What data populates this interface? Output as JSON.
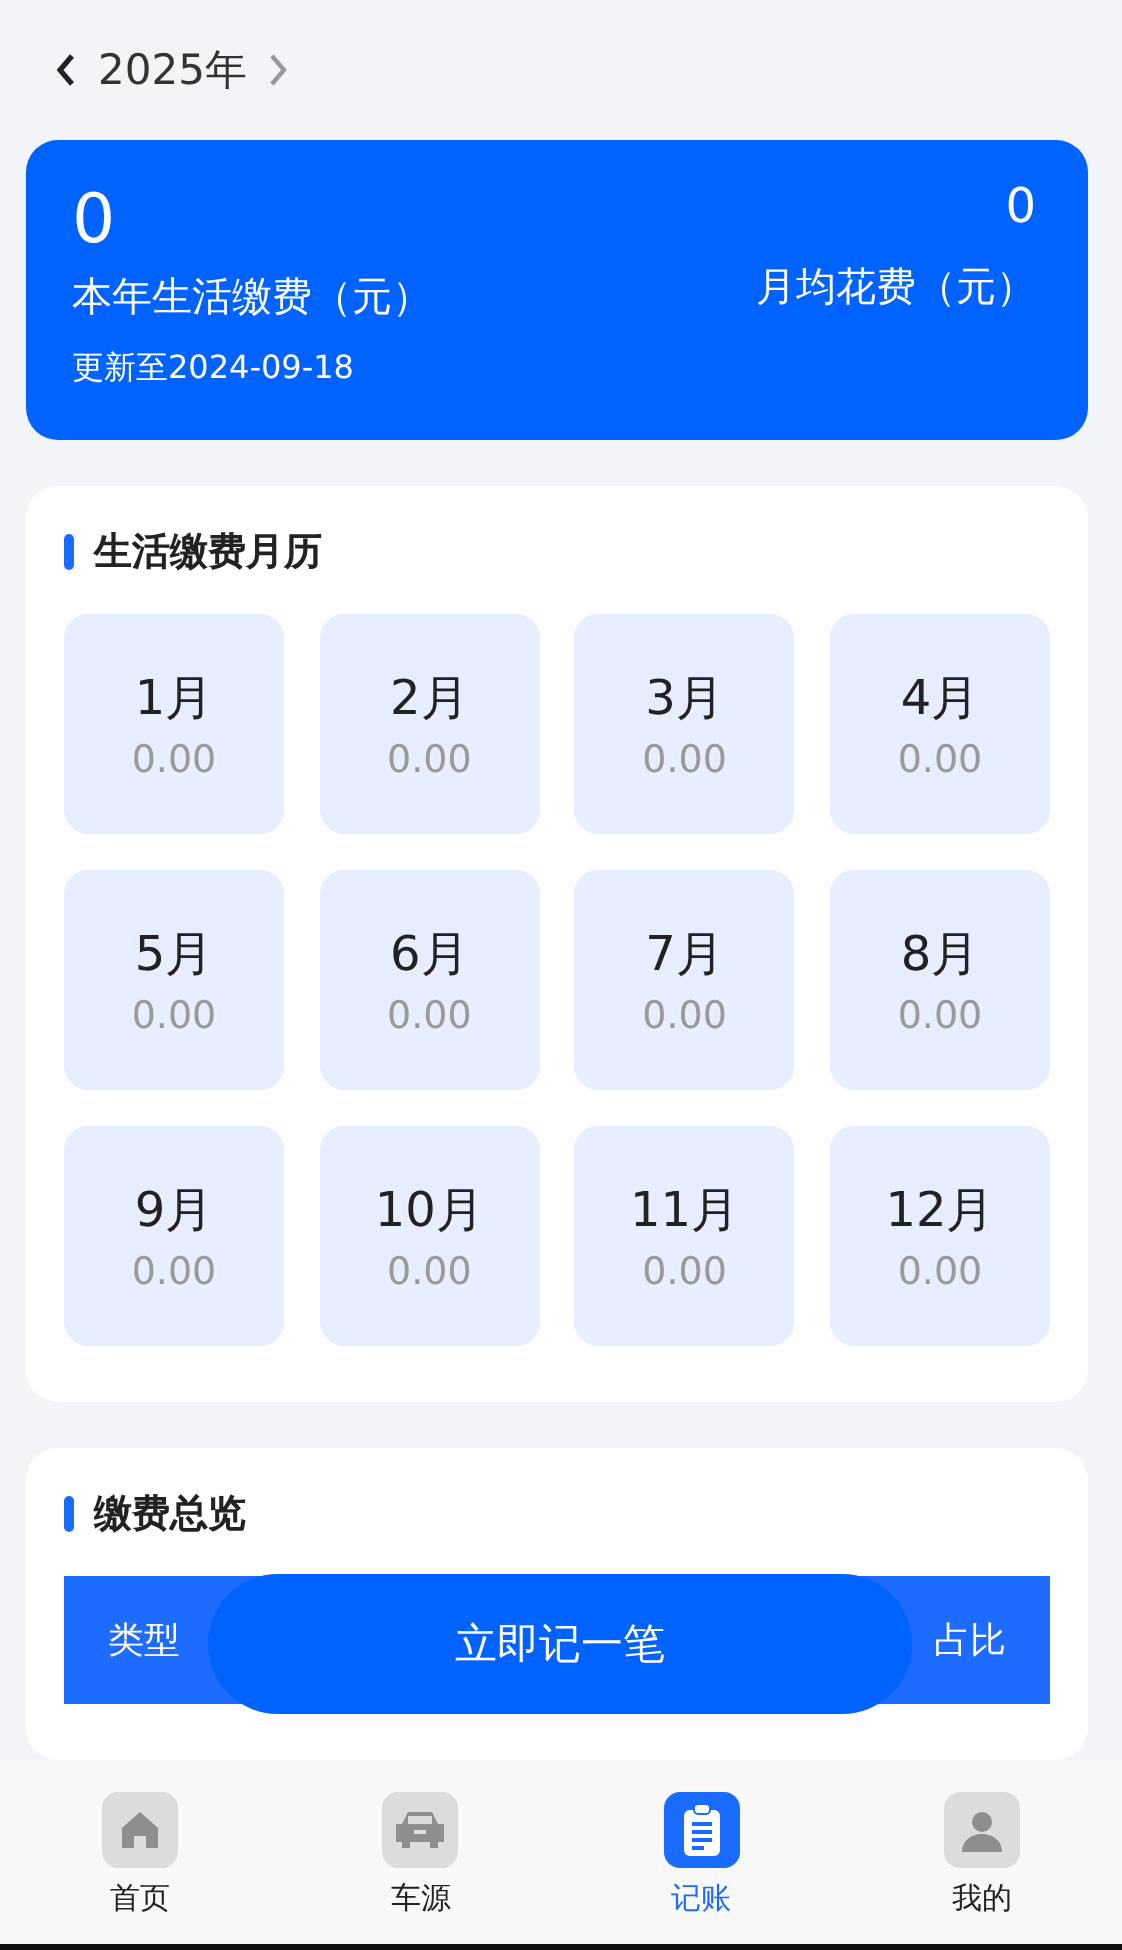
{
  "year_nav": {
    "label": "2025年"
  },
  "summary": {
    "total": "0",
    "total_label": "本年生活缴费（元）",
    "updated": "更新至2024-09-18",
    "monthly": "0",
    "monthly_label": "月均花费（元）"
  },
  "calendar": {
    "title": "生活缴费月历",
    "months": [
      {
        "month": "1月",
        "amount": "0.00"
      },
      {
        "month": "2月",
        "amount": "0.00"
      },
      {
        "month": "3月",
        "amount": "0.00"
      },
      {
        "month": "4月",
        "amount": "0.00"
      },
      {
        "month": "5月",
        "amount": "0.00"
      },
      {
        "month": "6月",
        "amount": "0.00"
      },
      {
        "month": "7月",
        "amount": "0.00"
      },
      {
        "month": "8月",
        "amount": "0.00"
      },
      {
        "month": "9月",
        "amount": "0.00"
      },
      {
        "month": "10月",
        "amount": "0.00"
      },
      {
        "month": "11月",
        "amount": "0.00"
      },
      {
        "month": "12月",
        "amount": "0.00"
      }
    ]
  },
  "overview": {
    "title": "缴费总览",
    "columns": [
      "类型",
      "占比"
    ]
  },
  "add_button": "立即记一笔",
  "tabs": [
    {
      "label": "首页",
      "kind": "home",
      "selected": false
    },
    {
      "label": "车源",
      "kind": "car",
      "selected": false
    },
    {
      "label": "记账",
      "kind": "ledger",
      "selected": true
    },
    {
      "label": "我的",
      "kind": "profile",
      "selected": false
    }
  ]
}
